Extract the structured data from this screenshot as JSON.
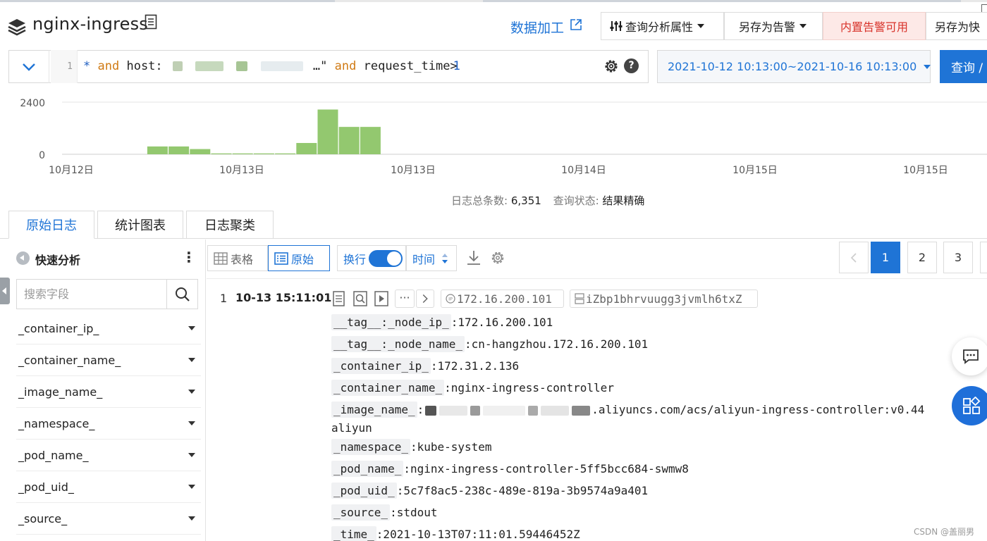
{
  "header": {
    "title": "nginx-ingress",
    "data_process": "数据加工",
    "query_attrs": "查询分析属性",
    "save_alert": "另存为告警",
    "builtin_alert": "内置告警可用",
    "save_as": "另存为快"
  },
  "query": {
    "line_number": "1",
    "token_star": "*",
    "token_and1": "and",
    "token_host": "host:",
    "token_host_end": "…\"",
    "token_and2": "and",
    "token_field": "request_time>",
    "token_value": "1",
    "time_range": "2021-10-12 10:13:00~2021-10-16 10:13:00",
    "submit_label": "查询 / "
  },
  "chart_data": {
    "type": "bar",
    "y_ticks": [
      "2400",
      "0"
    ],
    "ylim": [
      0,
      2400
    ],
    "x_ticks": [
      "10月12日",
      "10月13日",
      "10月13日",
      "10月14日",
      "10月15日",
      "10月15日"
    ],
    "values": [
      0,
      0,
      0,
      0,
      360,
      360,
      240,
      40,
      40,
      40,
      40,
      520,
      2060,
      1260,
      1260
    ],
    "bar_color": "#93c86f"
  },
  "summary": {
    "total_label": "日志总条数:",
    "total_value": "6,351",
    "status_label": "查询状态:",
    "status_value": "结果精确"
  },
  "tabs": [
    "原始日志",
    "统计图表",
    "日志聚类"
  ],
  "sidebar": {
    "title": "快速分析",
    "search_placeholder": "搜索字段",
    "fields": [
      "_container_ip_",
      "_container_name_",
      "_image_name_",
      "_namespace_",
      "_pod_name_",
      "_pod_uid_",
      "_source_"
    ]
  },
  "toolbar": {
    "table": "表格",
    "raw": "原始",
    "wrap": "换行",
    "time": "时间"
  },
  "pagination": [
    "1",
    "2",
    "3"
  ],
  "log": {
    "index": "1",
    "time": "10-13 15:11:01",
    "ip_tag": "172.16.200.101",
    "host_tag": "iZbp1bhrvuugg3jvmlh6txZ",
    "fields": [
      {
        "key": "__tag__:_node_ip_",
        "value": ":172.16.200.101"
      },
      {
        "key": "__tag__:_node_name_",
        "value": ":cn-hangzhou.172.16.200.101"
      },
      {
        "key": "_container_ip_",
        "value": ":172.31.2.136"
      },
      {
        "key": "_container_name_",
        "value": ":nginx-ingress-controller"
      },
      {
        "key": "_image_name_",
        "value": ".aliyuncs.com/acs/aliyun-ingress-controller:v0.44"
      },
      {
        "key": "",
        "value": "aliyun"
      },
      {
        "key": "_namespace_",
        "value": ":kube-system"
      },
      {
        "key": "_pod_name_",
        "value": ":nginx-ingress-controller-5ff5bcc684-swmw8"
      },
      {
        "key": "_pod_uid_",
        "value": ":5c7f8ac5-238c-489e-819a-3b9574a9a401"
      },
      {
        "key": "_source_",
        "value": ":stdout"
      },
      {
        "key": "_time_",
        "value": ":2021-10-13T07:11:01.59446452Z"
      }
    ]
  },
  "watermark": "CSDN @盖丽男"
}
